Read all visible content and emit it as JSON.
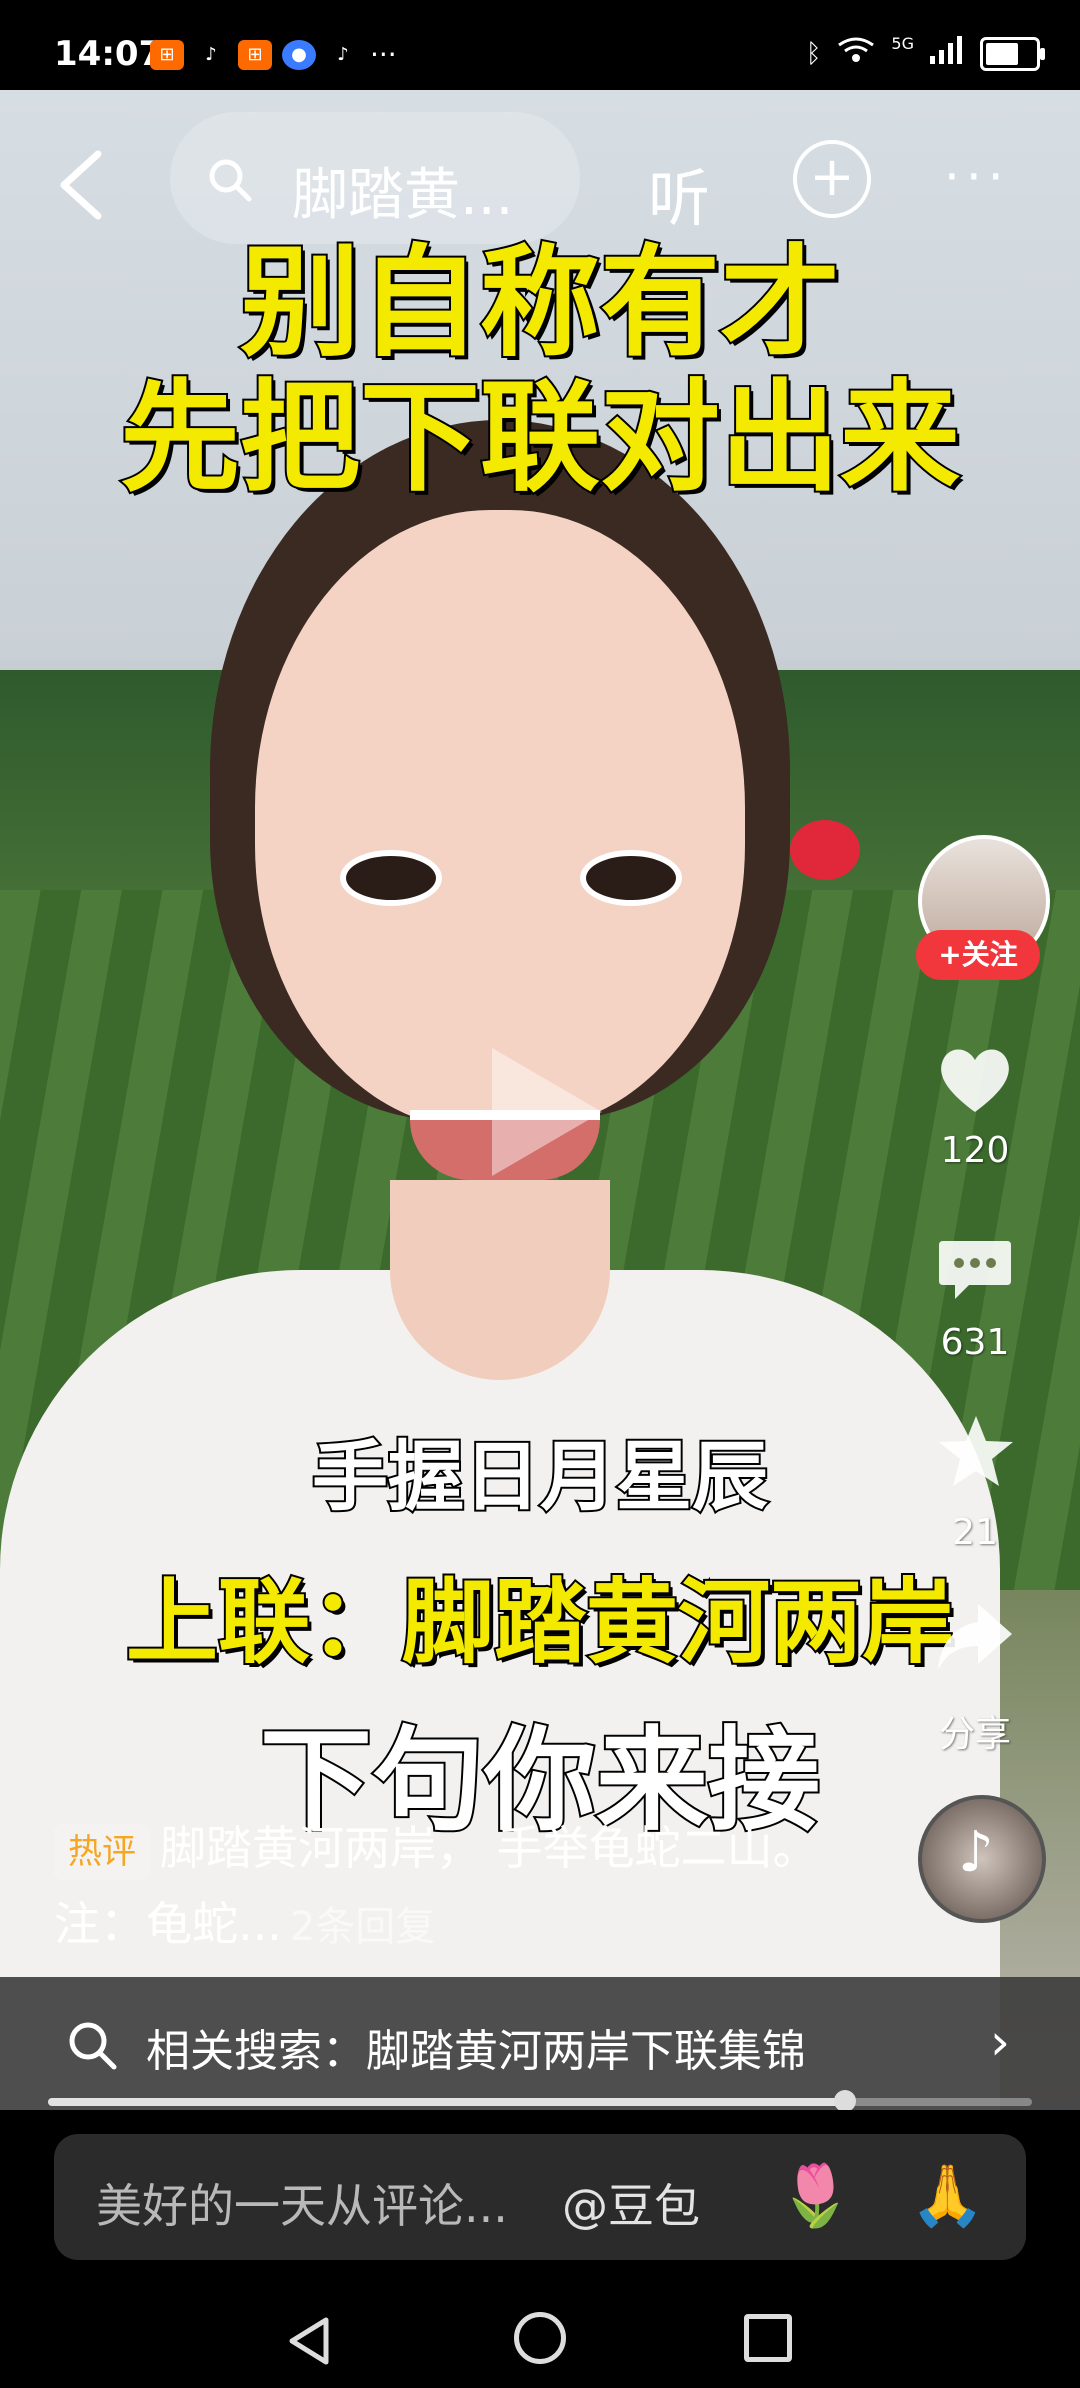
{
  "status_bar": {
    "time": "14:07",
    "more": "···",
    "network": "5G",
    "apps": [
      "app-1",
      "tiktok",
      "app-2",
      "app-3",
      "tiktok"
    ]
  },
  "top_bar": {
    "search_text": "脚踏黄...",
    "listen": "听",
    "plus": "+",
    "more": "···"
  },
  "captions": {
    "title_line1": "别自称有才",
    "title_line2": "先把下联对出来",
    "line_a": "手握日月星辰",
    "line_b": "上联：脚踏黄河两岸",
    "line_c": "下句你来接"
  },
  "side_actions": {
    "follow_label": "+关注",
    "likes": "120",
    "comments": "631",
    "favorites": "21",
    "share_label": "分享"
  },
  "hot_comment": {
    "badge": "热评",
    "text": "脚踏黄河两岸， 手举龟蛇二山。 注：龟蛇...",
    "replies": "2条回复"
  },
  "related_search": {
    "label": "相关搜索：脚踏黄河两岸下联集锦",
    "chevron": "›"
  },
  "comment_input": {
    "placeholder": "美好的一天从评论...",
    "mention": "@豆包",
    "emoji1": "🌷",
    "emoji2": "🙏"
  },
  "playback": {
    "progress": 0.81
  },
  "colors": {
    "caption_yellow": "#f4ea00",
    "follow_red": "#f1363c"
  }
}
